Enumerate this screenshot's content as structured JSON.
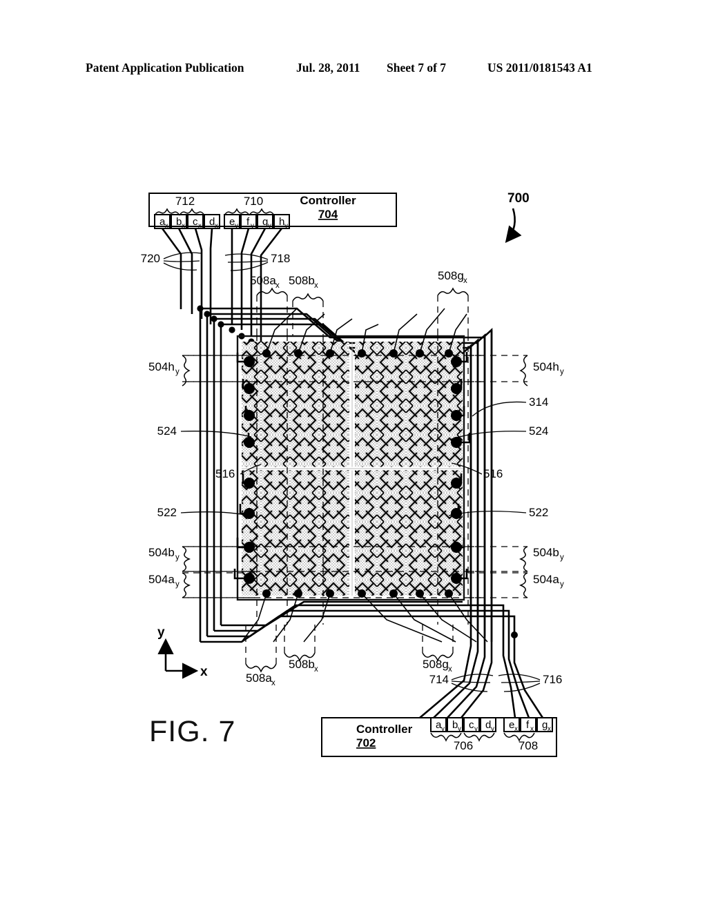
{
  "header": {
    "publication": "Patent Application Publication",
    "date": "Jul. 28, 2011",
    "sheet": "Sheet 7 of 7",
    "number": "US 2011/0181543 A1"
  },
  "figure": {
    "caption": "FIG. 7",
    "assembly_ref": "700",
    "axis_x": "x",
    "axis_y": "y"
  },
  "controllers": {
    "top": {
      "name": "Controller",
      "ref": "704",
      "groups": [
        {
          "ref": "712",
          "pins": [
            {
              "base": "a",
              "sub": "x"
            },
            {
              "base": "b",
              "sub": "x"
            },
            {
              "base": "c",
              "sub": "x"
            },
            {
              "base": "d",
              "sub": "x"
            }
          ]
        },
        {
          "ref": "710",
          "pins": [
            {
              "base": "e",
              "sub": "y"
            },
            {
              "base": "f",
              "sub": "y"
            },
            {
              "base": "g",
              "sub": "y"
            },
            {
              "base": "h",
              "sub": "y"
            }
          ]
        }
      ]
    },
    "bottom": {
      "name": "Controller",
      "ref": "702",
      "groups": [
        {
          "ref": "706",
          "pins": [
            {
              "base": "a",
              "sub": "y"
            },
            {
              "base": "b",
              "sub": "y"
            },
            {
              "base": "c",
              "sub": "y"
            },
            {
              "base": "d",
              "sub": "y"
            }
          ]
        },
        {
          "ref": "708",
          "pins": [
            {
              "base": "e",
              "sub": "x"
            },
            {
              "base": "f",
              "sub": "x"
            },
            {
              "base": "g",
              "sub": "x"
            }
          ]
        }
      ]
    }
  },
  "callouts": {
    "bundle_top_left": "720",
    "bundle_top_right": "718",
    "bundle_bottom_left": "714",
    "bundle_bottom_right": "716",
    "electrode_314": "314",
    "trace_524_left": "524",
    "trace_524_right": "524",
    "trace_522_left": "522",
    "trace_522_right": "522",
    "mesh_516_left": "516",
    "mesh_516_right": "516"
  },
  "column_labels": [
    {
      "base": "508a",
      "sub": "x",
      "position": "top-left"
    },
    {
      "base": "508b",
      "sub": "x",
      "position": "top-left-2"
    },
    {
      "base": "508g",
      "sub": "x",
      "position": "top-right"
    },
    {
      "base": "508a",
      "sub": "x",
      "position": "bottom-left"
    },
    {
      "base": "508b",
      "sub": "x",
      "position": "bottom-left-2"
    },
    {
      "base": "508g",
      "sub": "x",
      "position": "bottom-right"
    }
  ],
  "row_labels": [
    {
      "base": "504h",
      "sub": "y",
      "position": "left-top"
    },
    {
      "base": "504b",
      "sub": "y",
      "position": "left-lower"
    },
    {
      "base": "504a",
      "sub": "y",
      "position": "left-bottom"
    },
    {
      "base": "504h",
      "sub": "y",
      "position": "right-top"
    },
    {
      "base": "504b",
      "sub": "y",
      "position": "right-lower"
    },
    {
      "base": "504a",
      "sub": "y",
      "position": "right-bottom"
    }
  ]
}
